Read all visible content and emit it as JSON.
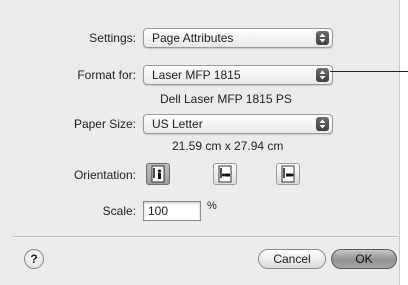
{
  "settings": {
    "label": "Settings:",
    "value": "Page Attributes"
  },
  "format_for": {
    "label": "Format for:",
    "value": "Laser MFP 1815",
    "printer_description": "Dell Laser MFP 1815 PS"
  },
  "paper_size": {
    "label": "Paper Size:",
    "value": "US Letter",
    "dimensions": "21.59 cm x 27.94 cm"
  },
  "orientation": {
    "label": "Orientation:",
    "options": [
      {
        "name": "portrait",
        "selected": true
      },
      {
        "name": "landscape-left",
        "selected": false
      },
      {
        "name": "landscape-right",
        "selected": false
      }
    ]
  },
  "scale": {
    "label": "Scale:",
    "value": "100",
    "unit": "%"
  },
  "buttons": {
    "help": "?",
    "cancel": "Cancel",
    "ok": "OK"
  },
  "icons": [
    "popup-arrows-icon",
    "portrait-icon",
    "landscape-left-icon",
    "landscape-right-icon",
    "help-icon"
  ]
}
